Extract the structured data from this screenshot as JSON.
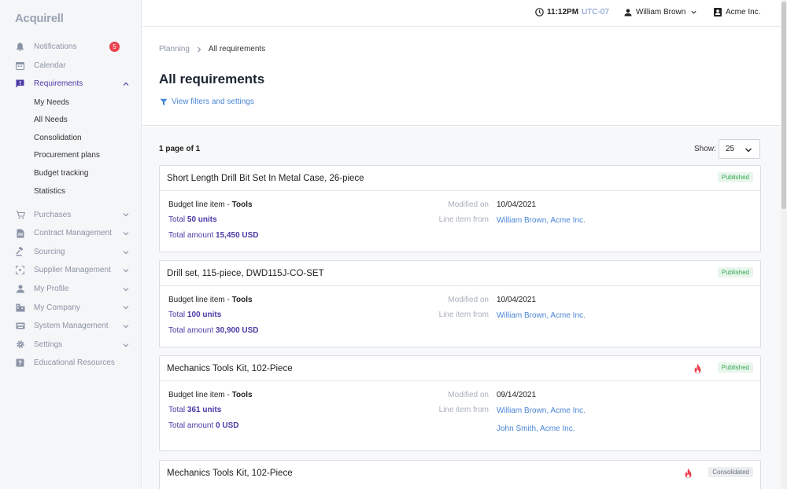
{
  "app": {
    "logo": "Acquirell"
  },
  "sidebar": {
    "notifications": {
      "label": "Notifications",
      "badge": "5"
    },
    "calendar": {
      "label": "Calendar"
    },
    "requirements": {
      "label": "Requirements"
    },
    "sub_items": [
      "My Needs",
      "All Needs",
      "Consolidation",
      "Procurement plans",
      "Budget tracking",
      "Statistics"
    ],
    "items": [
      "Purchases",
      "Contract Management",
      "Sourcing",
      "Supplier Management",
      "My Profile",
      "My Company",
      "System Management",
      "Settings"
    ],
    "educational": {
      "label": "Educational Resources"
    }
  },
  "topbar": {
    "time": "11:12PM",
    "timezone": "UTC-07",
    "user": "William Brown",
    "company": "Acme Inc."
  },
  "header": {
    "breadcrumb_parent": "Planning",
    "breadcrumb_current": "All requirements",
    "title": "All requirements",
    "filters_link": "View filters and settings"
  },
  "list": {
    "page_info": "1 page of 1",
    "show_label": "Show:",
    "show_value": "25"
  },
  "cards": [
    {
      "title": "Short Length Drill Bit Set In Metal Case, 26-piece",
      "status": "Published",
      "budget_prefix": "Budget line item - ",
      "budget_cat": "Tools",
      "total_prefix": "Total ",
      "total_units": "50 units",
      "amount_prefix": "Total amount ",
      "amount": "15,450 USD",
      "modified_label": "Modified on",
      "modified": "10/04/2021",
      "from_label": "Line item from",
      "from": "William Brown, Acme Inc."
    },
    {
      "title": "Drill set, 115-piece, DWD115J-CO-SET",
      "status": "Published",
      "budget_prefix": "Budget line item - ",
      "budget_cat": "Tools",
      "total_prefix": "Total ",
      "total_units": "100 units",
      "amount_prefix": "Total amount ",
      "amount": "30,900 USD",
      "modified_label": "Modified on",
      "modified": "10/04/2021",
      "from_label": "Line item from",
      "from": "William Brown, Acme Inc."
    },
    {
      "title": "Mechanics Tools Kit, 102-Piece",
      "status": "Published",
      "budget_prefix": "Budget line item - ",
      "budget_cat": "Tools",
      "total_prefix": "Total ",
      "total_units": "361 units",
      "amount_prefix": "Total amount ",
      "amount": "0 USD",
      "modified_label": "Modified on",
      "modified": "09/14/2021",
      "from_label": "Line item from",
      "from": "William Brown, Acme Inc.",
      "from2": "John Smith, Acme Inc."
    },
    {
      "title": "Mechanics Tools Kit, 102-Piece",
      "status": "Consolidated"
    }
  ],
  "colors": {
    "accent": "#4b3aa6",
    "link": "#4a86d6",
    "published": "#34a853",
    "badge": "#e8434f",
    "fire": "#e8434f"
  }
}
